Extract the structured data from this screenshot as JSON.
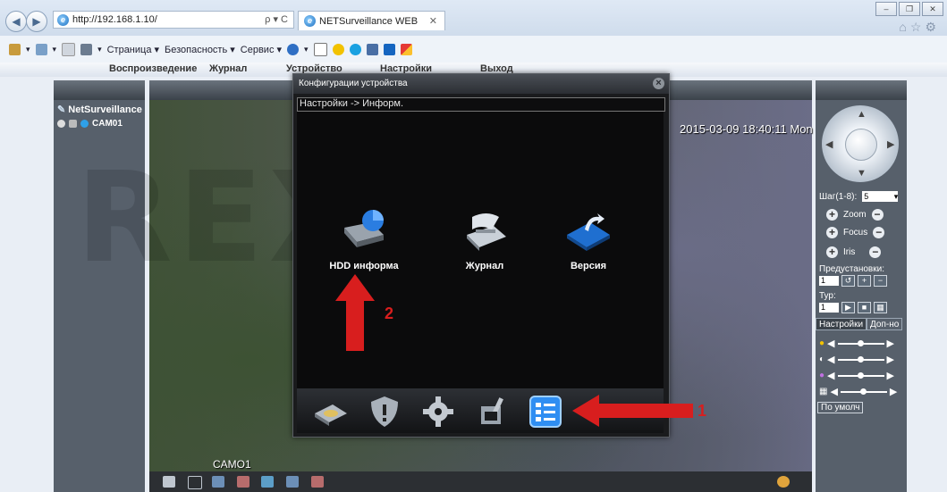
{
  "browser": {
    "url": "http://192.168.1.10/",
    "address_controls": "ρ ▾ C",
    "tab_title": "NETSurveillance WEB",
    "window_controls": [
      "min-icon",
      "restore-icon",
      "close-icon"
    ],
    "toolbar_icons": [
      "home-icon",
      "star-icon",
      "gear-icon"
    ],
    "command_bar": [
      "Страница ▾",
      "Безопасность ▾",
      "Сервис ▾"
    ]
  },
  "app_menu": {
    "items": [
      "Воспроизведение",
      "Журнал",
      "Устройство",
      "Настройки",
      "Выход"
    ]
  },
  "left_panel": {
    "site": "NetSurveillance",
    "camera": "CAM01"
  },
  "video": {
    "timestamp": "2015-03-09 18:40:11 Mon",
    "camera_label": "CAMO1",
    "watermark": "REXANT"
  },
  "dialog": {
    "title": "Конфигурации устройства",
    "breadcrumb": "Настройки -> Информ.",
    "items": [
      {
        "label": "HDD информа",
        "icon": "hdd-info-icon"
      },
      {
        "label": "Журнал",
        "icon": "log-icon"
      },
      {
        "label": "Версия",
        "icon": "version-icon"
      }
    ],
    "bottom_icons": [
      "hdd-icon",
      "shield-icon",
      "gear-icon",
      "tools-icon",
      "info-list-icon"
    ],
    "selected_bottom": "info-list-icon"
  },
  "right_panel": {
    "step_label": "Шаг(1-8):",
    "step_value": "5",
    "zoom_label": "Zoom",
    "focus_label": "Focus",
    "iris_label": "Iris",
    "presets_label": "Предустановки:",
    "preset_value": "1",
    "tour_label": "Тур:",
    "tour_value": "1",
    "tab_settings": "Настройки",
    "tab_extra": "Доп-но",
    "default_button": "По умолч"
  },
  "annotations": {
    "arrow1_number": "1",
    "arrow2_number": "2"
  },
  "colors": {
    "annotation_red": "#d81e1e",
    "dialog_bg": "#0b0b0c",
    "panel_gray": "#57606b"
  }
}
